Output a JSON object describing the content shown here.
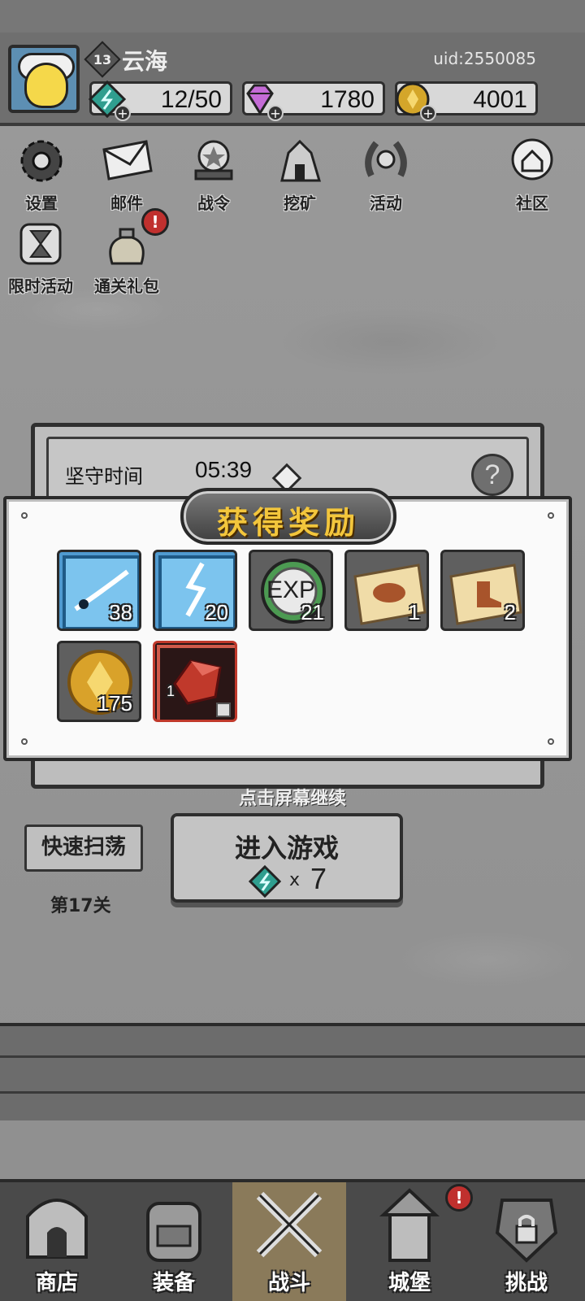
{
  "player": {
    "level": "13",
    "name": "云海",
    "uid": "uid:2550085"
  },
  "resources": {
    "stamina": "12/50",
    "gems": "1780",
    "gold": "4001"
  },
  "menu": {
    "settings": "设置",
    "mail": "邮件",
    "battle_pass": "战令",
    "mining": "挖矿",
    "events": "活动",
    "community": "社区",
    "limited_events": "限时活动",
    "clear_gift": "通关礼包",
    "alert_mark": "!"
  },
  "defense": {
    "hold_label": "坚守时间",
    "hold_time": "05:39",
    "help_label": "?"
  },
  "reward": {
    "title": "获得奖励",
    "items": [
      {
        "icon": "blue-slash-skill-icon",
        "qty": "38"
      },
      {
        "icon": "blue-lightning-skill-icon",
        "qty": "20"
      },
      {
        "icon": "exp-orb-icon",
        "label": "EXP",
        "qty": "21"
      },
      {
        "icon": "hat-scroll-icon",
        "qty": "1"
      },
      {
        "icon": "boot-scroll-icon",
        "qty": "2"
      },
      {
        "icon": "gold-coin-icon",
        "qty": "175"
      },
      {
        "icon": "red-crystal-icon",
        "qty": "1"
      }
    ],
    "tap_to_continue": "点击屏幕继续"
  },
  "actions": {
    "sweep": "快速扫荡",
    "stage": "第17关",
    "enter_game": "进入游戏",
    "cost_x": "x",
    "cost_value": "7"
  },
  "nav": {
    "shop": "商店",
    "equipment": "装备",
    "battle": "战斗",
    "castle": "城堡",
    "challenge": "挑战",
    "active_tab": "battle"
  },
  "colors": {
    "title_gold": "#f3c63c",
    "stamina_teal": "#2f9e8f",
    "gem_purple": "#c46bd6",
    "alert_red": "#c0302e",
    "rare_red": "#c0392b"
  }
}
